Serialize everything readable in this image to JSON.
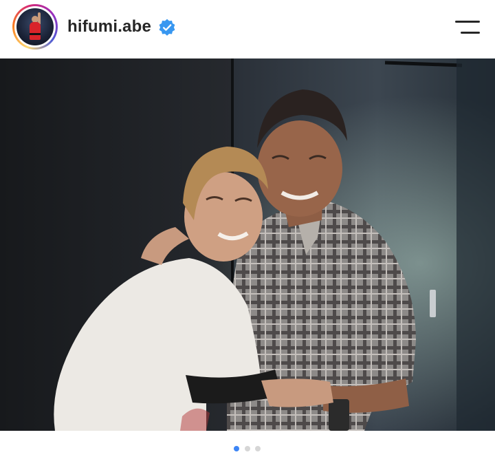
{
  "profile": {
    "username": "hifumi.abe",
    "verified": true,
    "avatar_icon": "profile-avatar",
    "story_ring_colors": [
      "#feda75",
      "#fa7e1e",
      "#d62976",
      "#962fbf",
      "#4f5bd5"
    ]
  },
  "header": {
    "menu_icon": "hamburger-menu-icon"
  },
  "post": {
    "user_tag_icon": "person-icon",
    "carousel": {
      "total": 3,
      "current": 1
    }
  },
  "colors": {
    "verified_blue": "#3897f0",
    "active_dot": "#3d85f5",
    "inactive_dot": "#d6d6d6",
    "text": "#262626"
  }
}
